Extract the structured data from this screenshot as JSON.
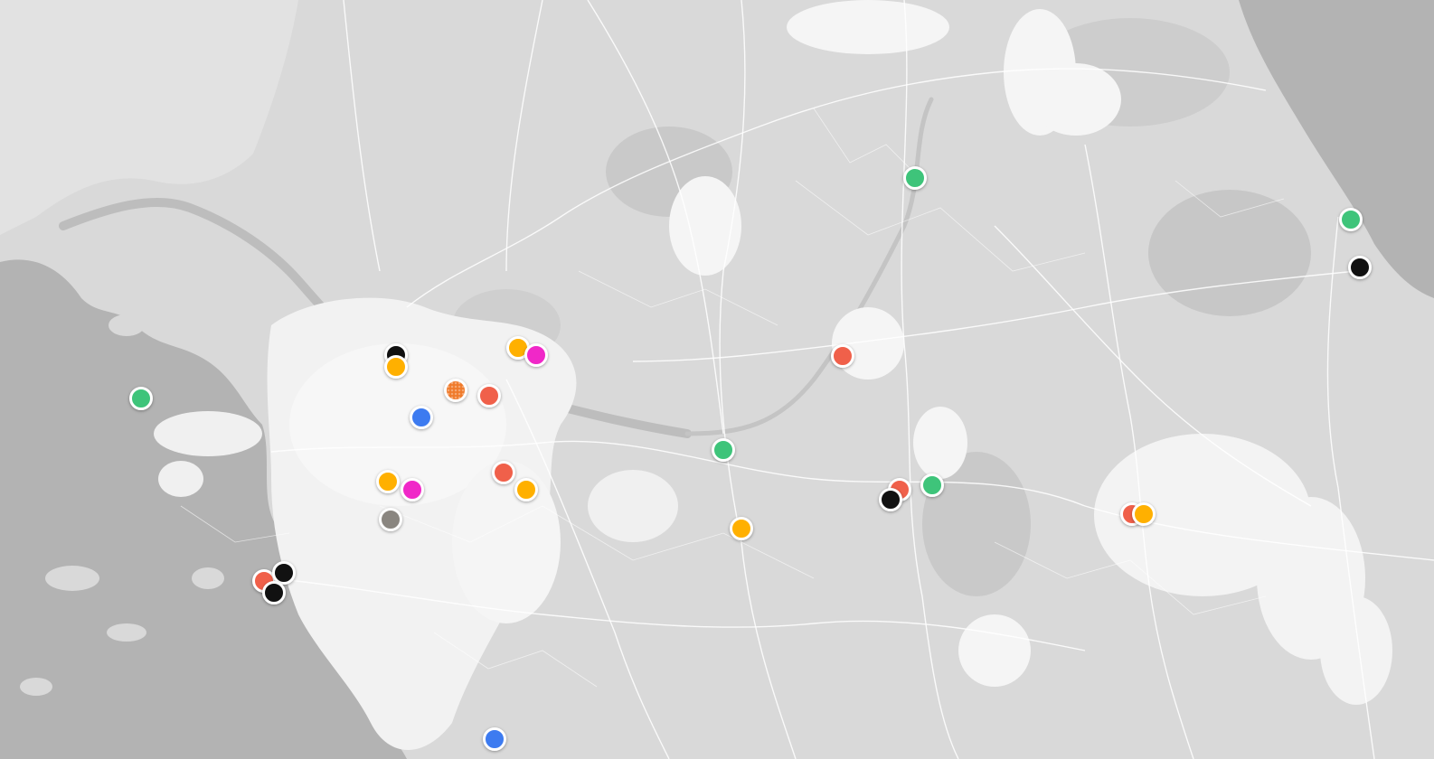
{
  "map": {
    "colors": {
      "sea": "#b3b3b3",
      "land": "#d9d9d9",
      "urban": "#f4f4f4",
      "relief": "#c9c9c9",
      "road": "#ffffff",
      "river": "#bdbdbd"
    },
    "markers": [
      {
        "id": "m1",
        "color": "#3ec47a"
      },
      {
        "id": "m2",
        "color": "#3ec47a"
      },
      {
        "id": "m3",
        "color": "#111111"
      },
      {
        "id": "m4",
        "color": "#3ec47a"
      },
      {
        "id": "m5",
        "color": "#111111"
      },
      {
        "id": "m6",
        "color": "#ffb000"
      },
      {
        "id": "m7",
        "color": "#ffb000"
      },
      {
        "id": "m8",
        "color": "#f028c8"
      },
      {
        "id": "m9",
        "color": "#f07a2a",
        "textured": true
      },
      {
        "id": "m10",
        "color": "#f0604a"
      },
      {
        "id": "m11",
        "color": "#3d7bf0"
      },
      {
        "id": "m12",
        "color": "#f0604a"
      },
      {
        "id": "m13",
        "color": "#3ec47a"
      },
      {
        "id": "m14",
        "color": "#f0604a"
      },
      {
        "id": "m15",
        "color": "#ffb000"
      },
      {
        "id": "m16",
        "color": "#f028c8"
      },
      {
        "id": "m17",
        "color": "#ffb000"
      },
      {
        "id": "m18",
        "color": "#8a8680"
      },
      {
        "id": "m19",
        "color": "#ffb000"
      },
      {
        "id": "m20",
        "color": "#f0604a"
      },
      {
        "id": "m21",
        "color": "#111111"
      },
      {
        "id": "m22",
        "color": "#3ec47a"
      },
      {
        "id": "m23",
        "color": "#f0604a"
      },
      {
        "id": "m24",
        "color": "#ffb000"
      },
      {
        "id": "m25",
        "color": "#f0604a"
      },
      {
        "id": "m26",
        "color": "#111111"
      },
      {
        "id": "m27",
        "color": "#111111"
      },
      {
        "id": "m28",
        "color": "#3d7bf0"
      }
    ]
  }
}
